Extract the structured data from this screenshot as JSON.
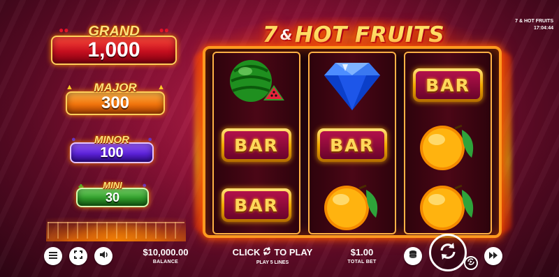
{
  "game": {
    "logo_main": "7",
    "logo_amp": "&",
    "logo_rest": "HOT FRUITS"
  },
  "corner": {
    "game_name": "7 & HOT FRUITS",
    "clock": "17:04:44"
  },
  "jackpots": {
    "grand": {
      "label": "GRAND",
      "value": "1,000"
    },
    "major": {
      "label": "MAJOR",
      "value": "300"
    },
    "minor": {
      "label": "MINOR",
      "value": "100"
    },
    "mini": {
      "label": "MINI",
      "value": "30"
    }
  },
  "reels": [
    [
      "watermelon",
      "bar",
      "bar"
    ],
    [
      "diamond",
      "bar",
      "orange"
    ],
    [
      "bar",
      "orange",
      "orange"
    ]
  ],
  "symbols": {
    "bar_label": "BAR"
  },
  "bottom": {
    "balance_value": "$10,000.00",
    "balance_label": "BALANCE",
    "click_left": "CLICK",
    "click_right": "TO PLAY",
    "lines_label": "PLAY 5 LINES",
    "bet_value": "$1.00",
    "bet_label": "TOTAL BET"
  },
  "icons": {
    "menu": "menu-icon",
    "fullscreen": "fullscreen-icon",
    "sound": "speaker-icon",
    "coins": "coin-stack-icon",
    "spin": "spin-arrows-icon",
    "autoplay": "autoplay-icon",
    "turbo": "fast-forward-icon"
  },
  "colors": {
    "grand": "#c40e1e",
    "major": "#f0730c",
    "minor": "#5b22d6",
    "mini": "#2f9a2a",
    "frame": "#ff9a1f"
  }
}
